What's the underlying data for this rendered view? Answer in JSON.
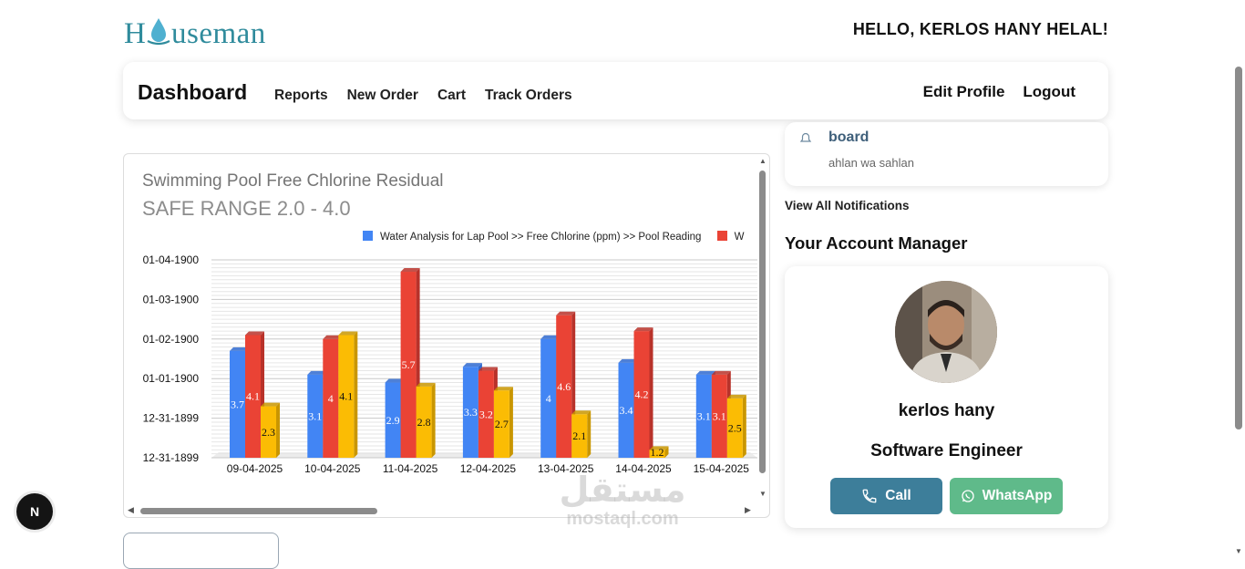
{
  "header": {
    "logo_text": "Houseman",
    "greeting": "HELLO, KERLOS HANY HELAL!"
  },
  "nav": {
    "brand": "Dashboard",
    "links": [
      "Reports",
      "New Order",
      "Cart",
      "Track Orders"
    ],
    "edit_profile": "Edit Profile",
    "logout": "Logout"
  },
  "chart_data": {
    "type": "bar",
    "title": "Swimming Pool Free Chlorine Residual",
    "subtitle": "SAFE RANGE 2.0 - 4.0",
    "categories": [
      "09-04-2025",
      "10-04-2025",
      "11-04-2025",
      "12-04-2025",
      "13-04-2025",
      "14-04-2025",
      "15-04-2025"
    ],
    "y_tick_labels": [
      "01-04-1900",
      "01-03-1900",
      "01-02-1900",
      "01-01-1900",
      "12-31-1899",
      "12-31-1899"
    ],
    "legend": [
      "Water Analysis for Lap Pool >> Free Chlorine (ppm) >> Pool Reading",
      "W"
    ],
    "series": [
      {
        "name": "Water Analysis for Lap Pool >> Free Chlorine (ppm) >> Pool Reading",
        "color": "#4285f4",
        "values": [
          3.7,
          3.1,
          2.9,
          3.3,
          4,
          3.4,
          3.1
        ]
      },
      {
        "name": "W",
        "color": "#ea4335",
        "values": [
          4.1,
          4,
          5.7,
          3.2,
          4.6,
          4.2,
          3.1
        ]
      },
      {
        "color": "#fbbc04",
        "values": [
          2.3,
          4.1,
          2.8,
          2.7,
          2.1,
          1.2,
          2.5
        ]
      }
    ],
    "ylim": [
      1,
      6
    ],
    "legend_position": "top",
    "grid": true
  },
  "notification": {
    "title": "board",
    "body": "ahlan wa sahlan",
    "view_all": "View All Notifications"
  },
  "account_manager": {
    "heading": "Your Account Manager",
    "name": "kerlos hany",
    "role": "Software Engineer",
    "call_label": "Call",
    "whatsapp_label": "WhatsApp"
  },
  "fab_label": "N",
  "watermark": {
    "arabic": "مستقل",
    "latin": "mostaql.com"
  }
}
